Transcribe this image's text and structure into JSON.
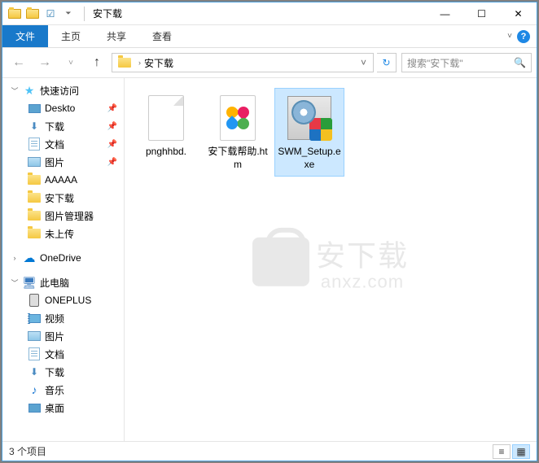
{
  "titlebar": {
    "title": "安下载"
  },
  "win_controls": {
    "min": "—",
    "max": "☐",
    "close": "✕"
  },
  "ribbon": {
    "file": "文件",
    "home": "主页",
    "share": "共享",
    "view": "查看"
  },
  "nav": {
    "back": "←",
    "forward": "→",
    "recent": "˅",
    "up": "↑"
  },
  "address": {
    "current": "安下载",
    "refresh": "↻"
  },
  "search": {
    "placeholder": "搜索\"安下载\""
  },
  "sidebar": {
    "quick_access": "快速访问",
    "items": [
      {
        "label": "Deskto",
        "icon": "desktop",
        "pinned": true
      },
      {
        "label": "下载",
        "icon": "download",
        "pinned": true
      },
      {
        "label": "文档",
        "icon": "doc",
        "pinned": true
      },
      {
        "label": "图片",
        "icon": "pic",
        "pinned": true
      },
      {
        "label": "AAAAA",
        "icon": "folder",
        "pinned": false
      },
      {
        "label": "安下载",
        "icon": "folder",
        "pinned": false
      },
      {
        "label": "图片管理器",
        "icon": "folder",
        "pinned": false
      },
      {
        "label": "未上传",
        "icon": "folder",
        "pinned": false
      }
    ],
    "onedrive": "OneDrive",
    "this_pc": "此电脑",
    "pc_items": [
      {
        "label": "ONEPLUS",
        "icon": "phone"
      },
      {
        "label": "视频",
        "icon": "video"
      },
      {
        "label": "图片",
        "icon": "pic"
      },
      {
        "label": "文档",
        "icon": "doc"
      },
      {
        "label": "下载",
        "icon": "download"
      },
      {
        "label": "音乐",
        "icon": "music"
      },
      {
        "label": "桌面",
        "icon": "desktop"
      }
    ]
  },
  "files": [
    {
      "name": "pnghhbd.",
      "type": "blank",
      "selected": false
    },
    {
      "name": "安下载帮助.htm",
      "type": "htm",
      "selected": false
    },
    {
      "name": "SWM_Setup.exe",
      "type": "exe",
      "selected": true
    }
  ],
  "watermark": {
    "cn": "安下载",
    "en": "anxz.com"
  },
  "status": {
    "text": "3 个项目"
  }
}
